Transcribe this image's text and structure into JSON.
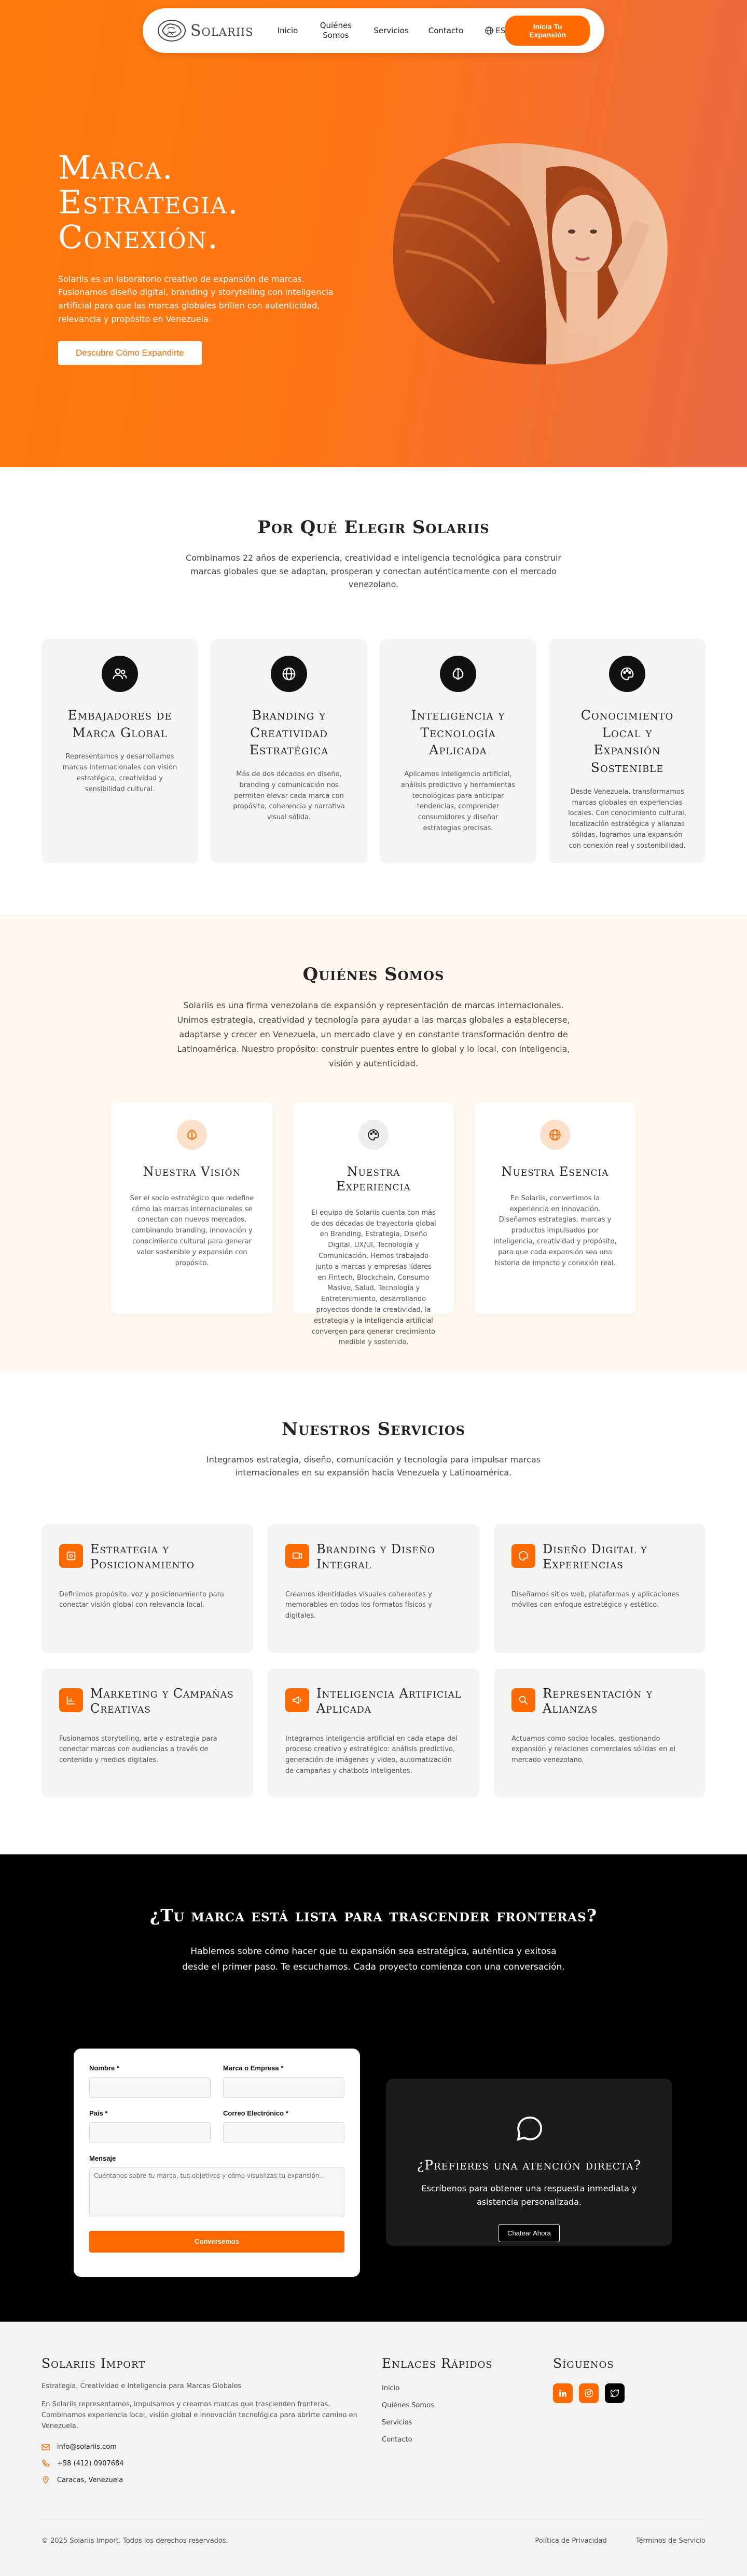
{
  "nav": {
    "logo_text": "Solariis",
    "links": [
      "Inicio",
      "Quiénes Somos",
      "Servicios",
      "Contacto"
    ],
    "lang": "ES",
    "cta": "Inicia Tu Expansión"
  },
  "hero": {
    "title_lines": [
      "Marca.",
      "Estrategia.",
      "Conexión."
    ],
    "subtitle": "Solariis es un laboratorio creativo de expansión de marcas. Fusionamos diseño digital, branding y storytelling con inteligencia artificial para que las marcas globales brillen con autenticidad, relevancia y propósito en Venezuela.",
    "button": "Descubre Cómo Expandirte"
  },
  "why": {
    "title": "Por Qué Elegir Solariis",
    "lead": "Combinamos 22 años de experiencia, creatividad e inteligencia tecnológica para construir marcas globales que se adaptan, prosperan y conectan auténticamente con el mercado venezolano.",
    "cards": [
      {
        "icon": "users-icon",
        "title": "Embajadores de Marca Global",
        "text": "Representamos y desarrollamos marcas internacionales con visión estratégica, creatividad y sensibilidad cultural."
      },
      {
        "icon": "globe-icon",
        "title": "Branding y Creatividad Estratégica",
        "text": "Más de dos décadas en diseño, branding y comunicación nos permiten elevar cada marca con propósito, coherencia y narrativa visual sólida."
      },
      {
        "icon": "brain-icon",
        "title": "Inteligencia y Tecnología Aplicada",
        "text": "Aplicamos inteligencia artificial, análisis predictivo y herramientas tecnológicas para anticipar tendencias, comprender consumidores y diseñar estrategias precisas."
      },
      {
        "icon": "palette-icon",
        "title": "Conocimiento Local y Expansión Sostenible",
        "text": "Desde Venezuela, transformamos marcas globales en experiencias locales. Con conocimiento cultural, localización estratégica y alianzas sólidas, logramos una expansión con conexión real y sostenibilidad."
      }
    ]
  },
  "about": {
    "title": "Quiénes Somos",
    "lead": "Solariis es una firma venezolana de expansión y representación de marcas internacionales. Unimos estrategia, creatividad y tecnología para ayudar a las marcas globales a establecerse, adaptarse y crecer en Venezuela, un mercado clave y en constante transformación dentro de Latinoamérica. Nuestro propósito: construir puentes entre lo global y lo local, con inteligencia, visión y autenticidad.",
    "cards": [
      {
        "icon": "brain-icon",
        "title": "Nuestra Visión",
        "text": "Ser el socio estratégico que redefine cómo las marcas internacionales se conectan con nuevos mercados, combinando branding, innovación y conocimiento cultural para generar valor sostenible y expansión con propósito."
      },
      {
        "icon": "palette-icon",
        "title": "Nuestra Experiencia",
        "text": "El equipo de Solariis cuenta con más de dos décadas de trayectoria global en Branding, Estrategia, Diseño Digital, UX/UI, Tecnología y Comunicación. Hemos trabajado junto a marcas y empresas líderes en Fintech, Blockchain, Consumo Masivo, Salud, Tecnología y Entretenimiento, desarrollando proyectos donde la creatividad, la estrategia y la inteligencia artificial convergen para generar crecimiento medible y sostenido."
      },
      {
        "icon": "globe-icon",
        "title": "Nuestra Esencia",
        "text": "En Solariis, convertimos la experiencia en innovación. Diseñamos estrategias, marcas y productos impulsados por inteligencia, creatividad y propósito, para que cada expansión sea una historia de impacto y conexión real."
      }
    ]
  },
  "services": {
    "title": "Nuestros Servicios",
    "lead": "Integramos estrategia, diseño, comunicación y tecnología para impulsar marcas internacionales en su expansión hacia Venezuela y Latinoamérica.",
    "cards": [
      {
        "icon": "target-icon",
        "title": "Estrategia y Posicionamiento",
        "text": "Definimos propósito, voz y posicionamiento para conectar visión global con relevancia local."
      },
      {
        "icon": "layers-icon",
        "title": "Branding y Diseño Integral",
        "text": "Creamos identidades visuales coherentes y memorables en todos los formatos físicos y digitales."
      },
      {
        "icon": "monitor-icon",
        "title": "Diseño Digital y Experiencias",
        "text": "Diseñamos sitios web, plataformas y aplicaciones móviles con enfoque estratégico y estético."
      },
      {
        "icon": "chart-icon",
        "title": "Marketing y Campañas Creativas",
        "text": "Fusionamos storytelling, arte y estrategia para conectar marcas con audiencias a través de contenido y medios digitales."
      },
      {
        "icon": "megaphone-icon",
        "title": "Inteligencia Artificial Aplicada",
        "text": "Integramos inteligencia artificial en cada etapa del proceso creativo y estratégico: análisis predictivo, generación de imágenes y video, automatización de campañas y chatbots inteligentes."
      },
      {
        "icon": "search-icon",
        "title": "Representación y Alianzas",
        "text": "Actuamos como socios locales, gestionando expansión y relaciones comerciales sólidas en el mercado venezolano."
      }
    ]
  },
  "contact": {
    "title": "¿Tu marca está lista para trascender fronteras?",
    "lead": "Hablemos sobre cómo hacer que tu expansión sea estratégica, auténtica y exitosa desde el primer paso. Te escuchamos. Cada proyecto comienza con una conversación.",
    "form": {
      "name_label": "Nombre *",
      "company_label": "Marca o Empresa *",
      "country_label": "País *",
      "email_label": "Correo Electrónico *",
      "message_label": "Mensaje",
      "message_placeholder": "Cuéntanos sobre tu marca, tus objetivos y cómo visualizas tu expansión...",
      "submit": "Conversemos"
    },
    "direct": {
      "title": "¿Prefieres una atención directa?",
      "text": "Escríbenos para obtener una respuesta inmediata y asistencia personalizada.",
      "button": "Chatear Ahora"
    }
  },
  "footer": {
    "brand": "Solariis Import",
    "tagline": "Estrategia, Creatividad e Inteligencia para Marcas Globales",
    "description": "En Solariis representamos, impulsamos y creamos marcas que trascienden fronteras. Combinamos experiencia local, visión global e innovación tecnológica para abrirte camino en Venezuela.",
    "email": "info@solariis.com",
    "phone": "+58 (412) 0907684",
    "location": "Caracas, Venezuela",
    "links_title": "Enlaces Rápidos",
    "links": [
      "Inicio",
      "Quiénes Somos",
      "Servicios",
      "Contacto"
    ],
    "social_title": "Síguenos",
    "copyright": "© 2025 Solariis Import. Todos los derechos reservados.",
    "privacy": "Política de Privacidad",
    "terms": "Términos de Servicio"
  },
  "colors": {
    "accent": "#ff6a00",
    "dark": "#111111",
    "peach": "#fde0c9",
    "cream": "#fff8ef"
  }
}
